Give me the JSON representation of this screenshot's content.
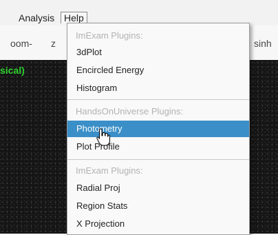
{
  "menubar": {
    "items": [
      {
        "label": "Analysis"
      },
      {
        "label": "Help"
      }
    ]
  },
  "toolbar": {
    "left_text": "oom-",
    "mid_text": "z",
    "right_text": "sinh"
  },
  "canvas": {
    "label": "sical)"
  },
  "menu": {
    "sections": [
      {
        "header": "ImExam Plugins:",
        "items": [
          "3dPlot",
          "Encircled Energy",
          "Histogram"
        ]
      },
      {
        "header": "HandsOnUniverse Plugins:",
        "items": [
          "Photometry",
          "Plot Profile"
        ]
      },
      {
        "header": "ImExam Plugins:",
        "items": [
          "Radial Proj",
          "Region Stats",
          "X Projection"
        ]
      }
    ],
    "highlighted": "Photometry"
  },
  "colors": {
    "highlight": "#3a8fc8",
    "canvas_label": "#2ed12e"
  }
}
